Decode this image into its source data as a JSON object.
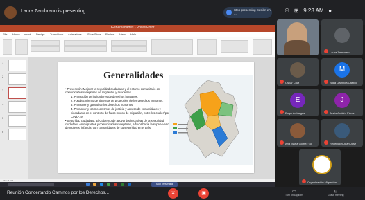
{
  "meet": {
    "presenter": "Laura Zambrano is presenting",
    "live_caption": "Stop presenting Sesión en ...",
    "clock": "9:23 AM",
    "meeting_title": "Reunión Concertando Caminos por los Derechos...",
    "bottom_right": [
      "Turn on captions",
      "Leave meeting"
    ],
    "stop_presenting": "Stop presenting"
  },
  "powerpoint": {
    "window_title": "Generalidades - PowerPoint",
    "menu": [
      "File",
      "Home",
      "Insert",
      "Design",
      "Transitions",
      "Animations",
      "Slide Show",
      "Review",
      "View",
      "Help"
    ],
    "slide_numbers": [
      "1",
      "2",
      "3",
      "4",
      "5",
      "6"
    ],
    "status": "Slide 3 of 6",
    "slide": {
      "title": "Generalidades",
      "paragraphs": [
        "• Prevención: Mejorar la seguridad ciudadana y el entorno comunitario en comunidades receptoras de migrantes y residentes.",
        "1. Promoción de indicadores de derechos humanos.",
        "2. Fortalecimiento de sistemas de protección de los derechos humanos.",
        "3. Promover y garantizar los derechos humanos.",
        "4. Promover y los mecanismos de justicia y acceso de comunidades y ciudadanía en el contexto de flujos mixtos de migración, entre los cuales/por el Covid-19.",
        "• Seguridad ciudadana: El Gobierno de apoyar las iniciativas de la seguridad ciudadana en migrantes y comunidades receptoras, a favor hacia la supervivencia de mujeres, infancia, con comunidades de su seguridad en el país."
      ]
    }
  },
  "participants": [
    {
      "name": "Laura Zambrano",
      "initial": "",
      "color": "#8a6a52"
    },
    {
      "name": "Laura Zambrano",
      "initial": "",
      "color": "#5f6368"
    },
    {
      "name": "Oscar Cruz",
      "initial": "",
      "color": "#6b5b4a"
    },
    {
      "name": "Nidia Gamboa Castillo",
      "initial": "M",
      "color": "#1a73e8"
    },
    {
      "name": "Eugenio Vargas",
      "initial": "E",
      "color": "#7627bb"
    },
    {
      "name": "Jesús Andrés Pérez",
      "initial": "J",
      "color": "#8e24aa"
    },
    {
      "name": "Ana María Gómez Gil",
      "initial": "",
      "color": "#8a5a3a"
    },
    {
      "name": "Recepción Juan José",
      "initial": "",
      "color": "#3a5a7a"
    },
    {
      "name": "Organización Migración",
      "initial": "",
      "color": "#ffffff"
    }
  ],
  "colors": {
    "ppt_accent": "#b7472a",
    "mic_off": "#ea4335",
    "map_orange": "#f6a21a",
    "map_green": "#3ea04a",
    "map_blue": "#2b7bd6"
  }
}
